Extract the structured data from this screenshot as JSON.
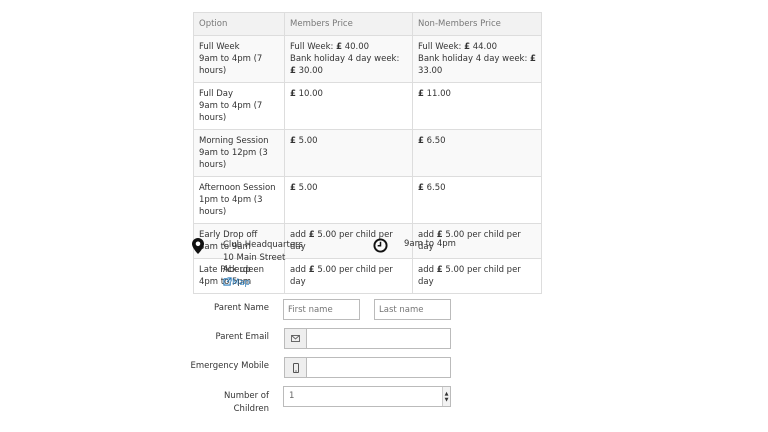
{
  "table": {
    "headers": [
      "Option",
      "Members Price",
      "Non-Members Price"
    ],
    "rows": [
      {
        "option_line1": "Full Week",
        "option_line2": "9am to 4pm (7 hours)",
        "members_line1": "Full Week: ",
        "members_amount1": "40.00",
        "members_line2": "Bank holiday 4 day week: ",
        "members_amount2": "30.00",
        "non_line1": "Full Week: ",
        "non_amount1": "44.00",
        "non_line2": "Bank holiday 4 day week: ",
        "non_amount2": "33.00"
      },
      {
        "option_line1": "Full Day",
        "option_line2": "9am to 4pm (7 hours)",
        "members_amount": "10.00",
        "non_amount": "11.00"
      },
      {
        "option_line1": "Morning Session",
        "option_line2": "9am to 12pm (3 hours)",
        "members_amount": "5.00",
        "non_amount": "6.50"
      },
      {
        "option_line1": "Afternoon Session",
        "option_line2": "1pm to 4pm (3 hours)",
        "members_amount": "5.00",
        "non_amount": "6.50"
      },
      {
        "option_line1": "Early Drop off",
        "option_line2": "8am to 9am",
        "members_prefix": "add ",
        "members_amount": "5.00",
        "members_suffix": " per child per day",
        "non_prefix": "add ",
        "non_amount": "5.00",
        "non_suffix": " per child per day"
      },
      {
        "option_line1": "Late Pick up",
        "option_line2": "4pm to 5pm",
        "members_prefix": "add ",
        "members_amount": "5.00",
        "members_suffix": " per child per day",
        "non_prefix": "add ",
        "non_amount": "5.00",
        "non_suffix": " per child per day"
      }
    ],
    "currency": "£"
  },
  "location": {
    "name": "Club Headquarters",
    "street": "10 Main Street",
    "city": "Aberdeen",
    "map_link": "Map",
    "icon": "map-marker-icon"
  },
  "hours": {
    "text": "9am to 4pm",
    "icon": "clock-icon"
  },
  "form": {
    "parent_name_label": "Parent Name",
    "first_name_placeholder": "First name",
    "last_name_placeholder": "Last name",
    "parent_email_label": "Parent Email",
    "emergency_mobile_label": "Emergency Mobile",
    "children_label_line1": "Number of",
    "children_label_line2": "Children",
    "children_value": "1"
  },
  "colors": {
    "link": "#2a7ab8",
    "header_bg": "#f2f2f2"
  }
}
